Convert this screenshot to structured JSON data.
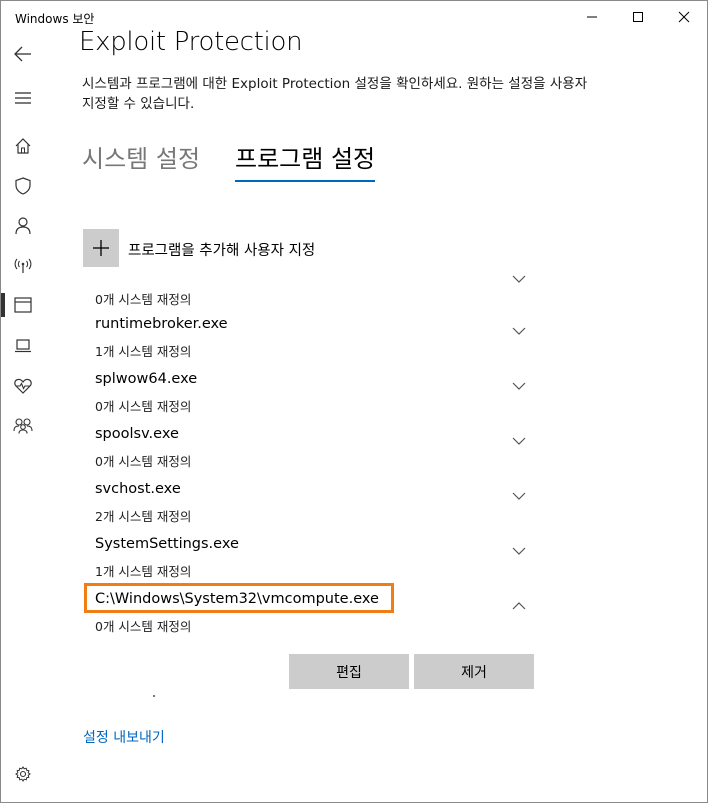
{
  "window": {
    "title": "Windows 보안"
  },
  "sidebar": {
    "items": [
      {
        "icon": "back-arrow-icon"
      },
      {
        "icon": "hamburger-menu-icon"
      },
      {
        "icon": "home-icon"
      },
      {
        "icon": "shield-icon"
      },
      {
        "icon": "person-icon"
      },
      {
        "icon": "wifi-antenna-icon"
      },
      {
        "icon": "app-browser-icon",
        "active": true
      },
      {
        "icon": "laptop-icon"
      },
      {
        "icon": "heart-health-icon"
      },
      {
        "icon": "family-icon"
      },
      {
        "icon": "gear-icon"
      }
    ]
  },
  "page": {
    "title": "Exploit Protection",
    "description": "시스템과 프로그램에 대한 Exploit Protection 설정을 확인하세요. 원하는 설정을 사용자 지정할 수 있습니다."
  },
  "tabs": {
    "system": "시스템 설정",
    "program": "프로그램 설정",
    "active": "program"
  },
  "add_program": {
    "label": "프로그램을 추가해 사용자 지정"
  },
  "programs": [
    {
      "name": "",
      "overrides": "0개 시스템 재정의",
      "expanded": false
    },
    {
      "name": "runtimebroker.exe",
      "overrides": "1개 시스템 재정의",
      "expanded": false
    },
    {
      "name": "splwow64.exe",
      "overrides": "0개 시스템 재정의",
      "expanded": false
    },
    {
      "name": "spoolsv.exe",
      "overrides": "0개 시스템 재정의",
      "expanded": false
    },
    {
      "name": "svchost.exe",
      "overrides": "2개 시스템 재정의",
      "expanded": false
    },
    {
      "name": "SystemSettings.exe",
      "overrides": "1개 시스템 재정의",
      "expanded": false
    },
    {
      "name": "C:\\Windows\\System32\\vmcompute.exe",
      "overrides": "0개 시스템 재정의",
      "expanded": true,
      "highlighted": true
    }
  ],
  "actions": {
    "edit": "편집",
    "remove": "제거"
  },
  "export_link": "설정 내보내기",
  "colors": {
    "accent": "#0067c0",
    "highlight": "#f07e14",
    "button_bg": "#cccccc"
  }
}
